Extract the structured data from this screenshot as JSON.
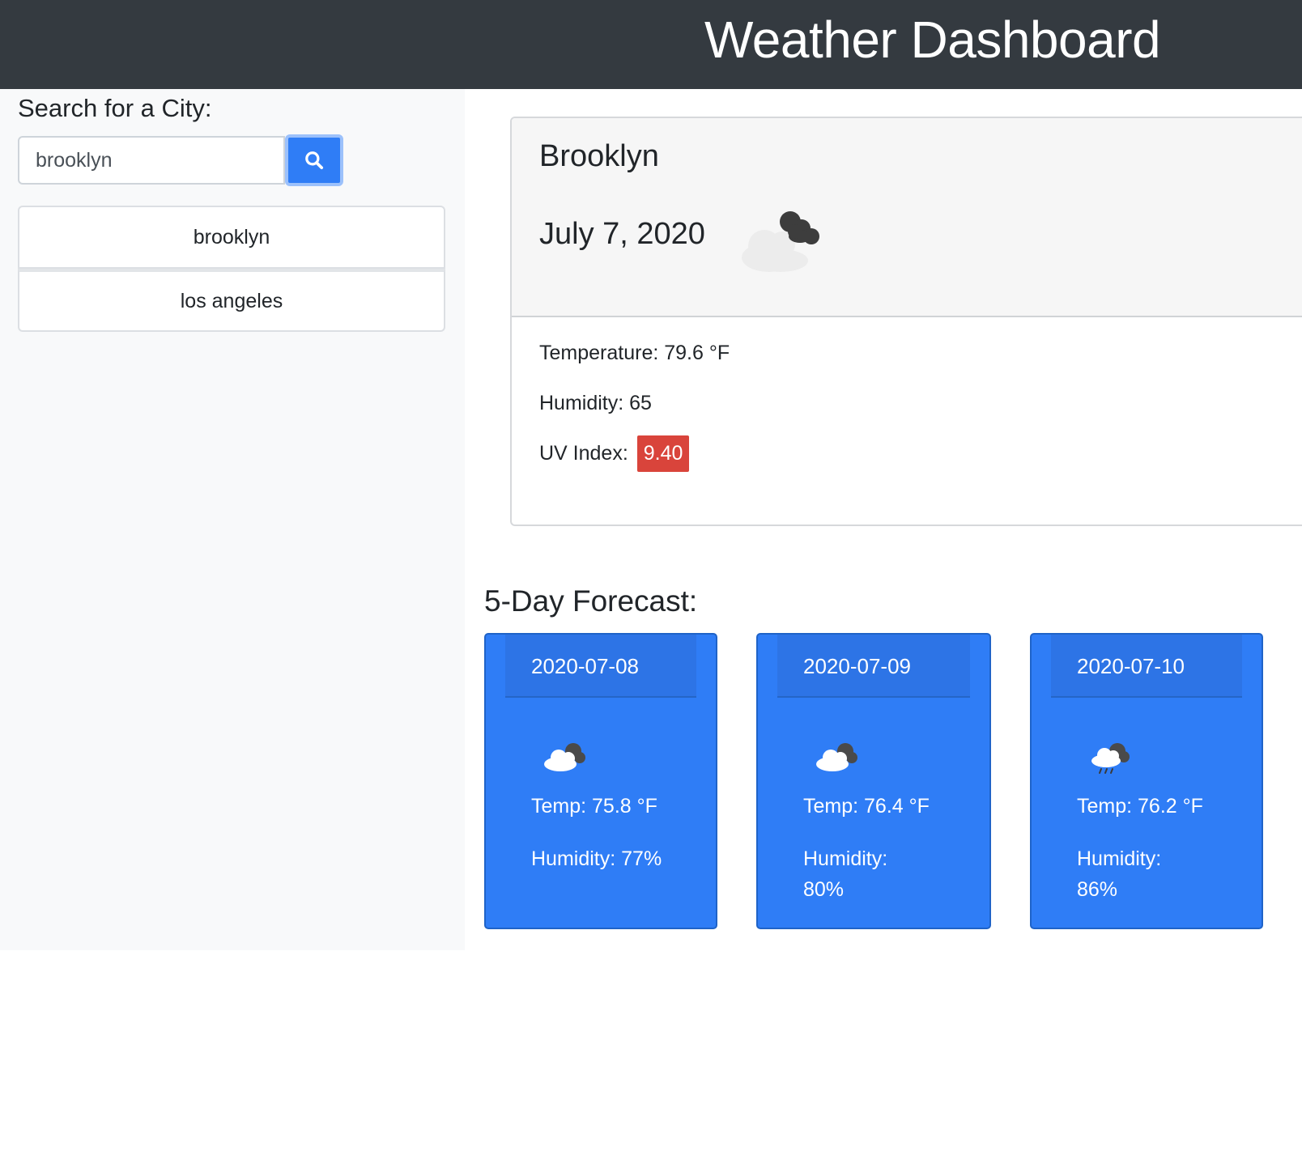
{
  "header": {
    "title": "Weather Dashboard"
  },
  "sidebar": {
    "search_label": "Search for a City:",
    "search_value": "brooklyn",
    "history": [
      "brooklyn",
      "los angeles"
    ]
  },
  "current": {
    "city": "Brooklyn",
    "date": "July 7, 2020",
    "icon": "broken-clouds-icon",
    "temperature": "Temperature: 79.6 °F",
    "humidity": "Humidity: 65",
    "uv_label": "UV Index:",
    "uv_value": "9.40",
    "uv_color": "#d9443b"
  },
  "forecast": {
    "title": "5-Day Forecast:",
    "days": [
      {
        "date": "2020-07-08",
        "icon": "cloudy-icon",
        "temp": "Temp: 75.8 °F",
        "humidity_label": "Humidity:",
        "humidity_value": "77%"
      },
      {
        "date": "2020-07-09",
        "icon": "cloudy-icon",
        "temp": "Temp: 76.4 °F",
        "humidity_label": "Humidity:",
        "humidity_value": "80%"
      },
      {
        "date": "2020-07-10",
        "icon": "rain-icon",
        "temp": "Temp: 76.2 °F",
        "humidity_label": "Humidity:",
        "humidity_value": "86%"
      }
    ]
  },
  "colors": {
    "accent": "#2f7df6",
    "navbar": "#343a40",
    "sidebar": "#f8f9fa"
  }
}
